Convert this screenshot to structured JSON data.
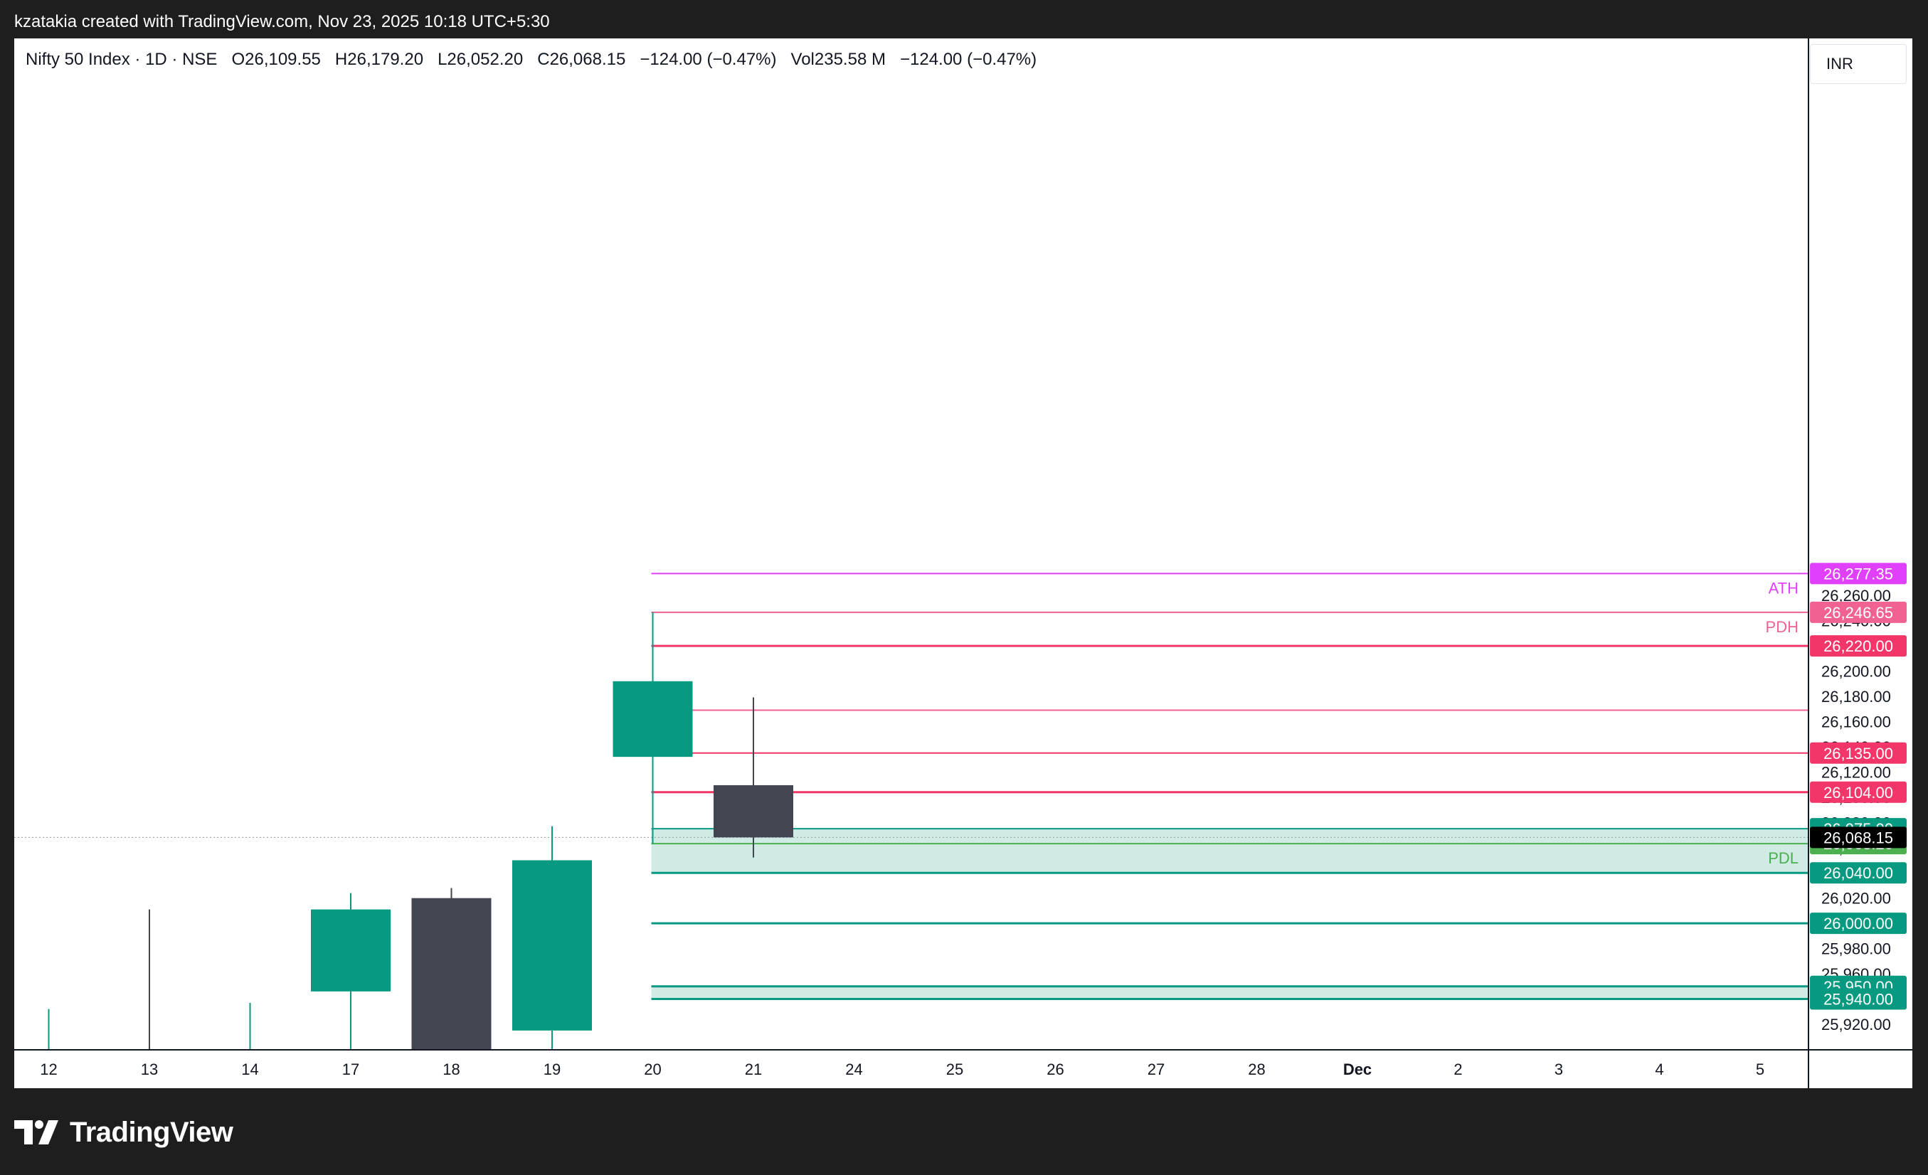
{
  "header": {
    "caption": "kzatakia created with TradingView.com, Nov 23, 2025 10:18 UTC+5:30"
  },
  "legend": {
    "symbol": "Nifty 50 Index · 1D · NSE",
    "open_label": "O",
    "open": "26,109.55",
    "high_label": "H",
    "high": "26,179.20",
    "low_label": "L",
    "low": "26,052.20",
    "close_label": "C",
    "close": "26,068.15",
    "change": "−124.00 (−0.47%)",
    "vol_label": "Vol",
    "vol": "235.58 M",
    "vol_change": "−124.00 (−0.47%)"
  },
  "currency": "INR",
  "footer": {
    "brand": "TradingView",
    "logo_icon": "tradingview-logo-icon"
  },
  "colors": {
    "up": "#089981",
    "down": "#434651",
    "ath": "#e040fb",
    "pdh": "#f06292",
    "red_level": "#f23669",
    "green_level": "#089981",
    "zone_fill": "#cfebe4",
    "pdl": "#4caf50",
    "current_price": "#000000"
  },
  "chart_data": {
    "type": "candlestick",
    "title": "Nifty 50 Index · 1D · NSE",
    "x_ticks": [
      "12",
      "13",
      "14",
      "17",
      "18",
      "19",
      "20",
      "21",
      "24",
      "25",
      "26",
      "27",
      "28",
      "Dec",
      "2",
      "3",
      "4",
      "5"
    ],
    "y_ticks": [
      "25,920.00",
      "25,940.00",
      "25,960.00",
      "25,980.00",
      "26,000.00",
      "26,020.00",
      "26,040.00",
      "26,060.00",
      "26,080.00",
      "26,100.00",
      "26,120.00",
      "26,140.00",
      "26,160.00",
      "26,180.00",
      "26,200.00",
      "26,220.00",
      "26,240.00",
      "26,260.00",
      "26,280.00"
    ],
    "ylim": [
      25906,
      26308
    ],
    "candles": [
      {
        "date": "12",
        "open": null,
        "high": 25932,
        "low": null,
        "close": null
      },
      {
        "date": "13",
        "open": null,
        "high": 26011,
        "low": null,
        "close": null
      },
      {
        "date": "14",
        "open": null,
        "high": 25937,
        "low": null,
        "close": null
      },
      {
        "date": "17",
        "open": 25946,
        "high": 26024,
        "low": null,
        "close": 26011
      },
      {
        "date": "18",
        "open": 26020,
        "high": 26028,
        "low": null,
        "close": null
      },
      {
        "date": "19",
        "open": 25915,
        "high": 26077,
        "low": null,
        "close": 26050
      },
      {
        "date": "20",
        "open": 26132,
        "high": 26246.65,
        "low": 26063.2,
        "close": 26192
      },
      {
        "date": "21",
        "open": 26109.55,
        "high": 26179.2,
        "low": 26052.2,
        "close": 26068.15
      }
    ],
    "horizontal_levels": [
      {
        "price": 26277.35,
        "label": "26,277.35",
        "name": "ATH",
        "color": "#e040fb",
        "width": 2,
        "tag": true
      },
      {
        "price": 26246.65,
        "label": "26,246.65",
        "name": "PDH",
        "color": "#f06292",
        "width": 2,
        "tag": true
      },
      {
        "price": 26220.0,
        "label": "26,220.00",
        "color": "#f23669",
        "width": 3,
        "tag": true
      },
      {
        "price": 26169.0,
        "label": "",
        "color": "#f06292",
        "width": 2,
        "tag": false
      },
      {
        "price": 26135.0,
        "label": "26,135.00",
        "color": "#f23669",
        "width": 2,
        "tag": true
      },
      {
        "price": 26104.0,
        "label": "26,104.00",
        "color": "#f23669",
        "width": 3,
        "tag": true
      },
      {
        "price": 26075.0,
        "label": "26,075.00",
        "color": "#089981",
        "width": 2,
        "tag": true
      },
      {
        "price": 26063.2,
        "label": "26,063.20",
        "name": "PDL",
        "color": "#4caf50",
        "width": 2,
        "tag": true
      },
      {
        "price": 26040.0,
        "label": "26,040.00",
        "color": "#089981",
        "width": 3,
        "tag": true
      },
      {
        "price": 26000.0,
        "label": "26,000.00",
        "color": "#089981",
        "width": 3,
        "tag": true
      },
      {
        "price": 25950.0,
        "label": "25,950.00",
        "color": "#089981",
        "width": 3,
        "tag": true
      },
      {
        "price": 25940.0,
        "label": "25,940.00",
        "color": "#089981",
        "width": 3,
        "tag": true
      }
    ],
    "zones": [
      {
        "top": 26075.0,
        "bottom": 26040.0,
        "color": "#cfebe4"
      },
      {
        "top": 25950.0,
        "bottom": 25940.0,
        "color": "#cfebe4"
      }
    ],
    "current_price": {
      "price": 26068.15,
      "label": "26,068.15"
    }
  }
}
